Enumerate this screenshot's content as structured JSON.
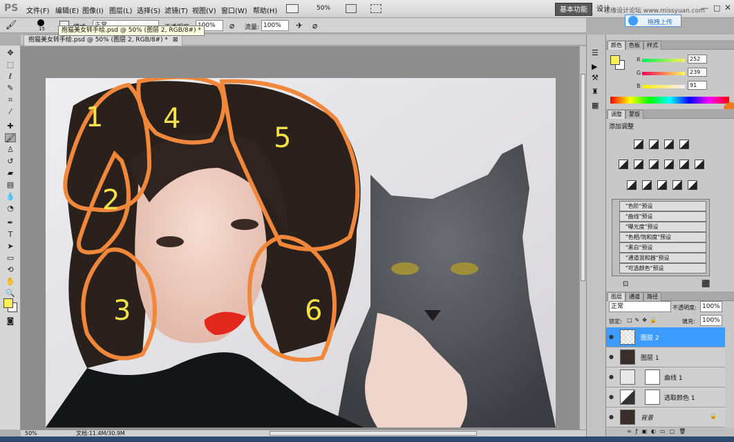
{
  "app": {
    "logo": "PS"
  },
  "menu": [
    {
      "label": "文件(F)"
    },
    {
      "label": "编辑(E)"
    },
    {
      "label": "图像(I)"
    },
    {
      "label": "图层(L)"
    },
    {
      "label": "选择(S)"
    },
    {
      "label": "滤镜(T)"
    },
    {
      "label": "视图(V)"
    },
    {
      "label": "窗口(W)"
    },
    {
      "label": "帮助(H)"
    }
  ],
  "menubar": {
    "zoom": "50%",
    "workspace_basic": "基本功能",
    "workspace_design": "设计",
    "watermark": "思缘设计论坛 www.missyuan.com"
  },
  "options": {
    "brush_size": "15",
    "mode_label": "模式:",
    "mode_value": "正常",
    "opacity_label": "不透明度:",
    "opacity_value": "100%",
    "flow_label": "流量:",
    "flow_value": "100%"
  },
  "tooltip": "抱猫美女转手绘.psd @ 50% (图层 2, RGB/8#) *",
  "document_tab": "抱猫美女转手绘.psd @ 50% (图层 2, RGB/8#) *",
  "status": {
    "zoom": "50%",
    "doc_size": "文档:11.4M/30.9M"
  },
  "cloud": {
    "upload_label": "拖拽上传"
  },
  "annotations": [
    {
      "label": "1",
      "color": "#f5e24a"
    },
    {
      "label": "2",
      "color": "#f5e24a"
    },
    {
      "label": "3",
      "color": "#f5e24a"
    },
    {
      "label": "4",
      "color": "#f5e24a"
    },
    {
      "label": "5",
      "color": "#f5e24a"
    },
    {
      "label": "6",
      "color": "#f5e24a"
    }
  ],
  "color_panel": {
    "tabs": [
      "颜色",
      "色板",
      "样式"
    ],
    "r_label": "R",
    "g_label": "G",
    "b_label": "B",
    "r": "252",
    "g": "239",
    "b": "91",
    "foreground": "#fcef5b"
  },
  "adjust_panel": {
    "tabs": [
      "调整",
      "蒙版"
    ],
    "heading": "添加调整",
    "presets": [
      "\"色阶\"预设",
      "\"曲线\"预设",
      "\"曝光度\"预设",
      "\"色相/饱和度\"预设",
      "\"黑白\"预设",
      "\"通道混和器\"预设",
      "\"可选颜色\"预设"
    ]
  },
  "layers_panel": {
    "tabs": [
      "图层",
      "通道",
      "路径"
    ],
    "blend_mode": "正常",
    "opacity_label": "不透明度:",
    "opacity_value": "100%",
    "lock_label": "锁定:",
    "fill_label": "填充:",
    "fill_value": "100%",
    "layers": [
      {
        "name": "图层 2",
        "selected": true
      },
      {
        "name": "图层 1",
        "selected": false
      },
      {
        "name": "曲线 1",
        "selected": false
      },
      {
        "name": "选取颜色 1",
        "selected": false
      },
      {
        "name": "背景",
        "selected": false
      }
    ]
  },
  "colors": {
    "accent": "#3d9cff",
    "annotation_stroke": "#f0873a"
  }
}
